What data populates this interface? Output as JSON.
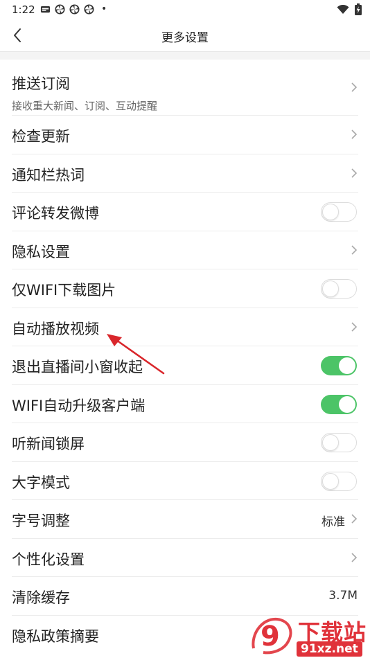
{
  "status_bar": {
    "time": "1:22",
    "dot": "•",
    "icons": [
      "app-notification-icon",
      "pinwheel-icon",
      "pinwheel-icon",
      "pinwheel-icon",
      "wifi-icon",
      "battery-charging-icon"
    ]
  },
  "header": {
    "title": "更多设置",
    "back_icon": "back-chevron-icon"
  },
  "settings": [
    {
      "label": "推送订阅",
      "subtitle": "接收重大新闻、订阅、互动提醒",
      "control": "chevron"
    },
    {
      "label": "检查更新",
      "control": "chevron"
    },
    {
      "label": "通知栏热词",
      "control": "chevron"
    },
    {
      "label": "评论转发微博",
      "control": "toggle",
      "on": false
    },
    {
      "label": "隐私设置",
      "control": "chevron"
    },
    {
      "label": "仅WIFI下载图片",
      "control": "toggle",
      "on": false
    },
    {
      "label": "自动播放视频",
      "control": "chevron"
    },
    {
      "label": "退出直播间小窗收起",
      "control": "toggle",
      "on": true
    },
    {
      "label": "WIFI自动升级客户端",
      "control": "toggle",
      "on": true
    },
    {
      "label": "听新闻锁屏",
      "control": "toggle",
      "on": false
    },
    {
      "label": "大字模式",
      "control": "toggle",
      "on": false
    },
    {
      "label": "字号调整",
      "value": "标准",
      "control": "chevron"
    },
    {
      "label": "个性化设置",
      "control": "chevron"
    },
    {
      "label": "清除缓存",
      "value": "3.7M",
      "control": "none"
    },
    {
      "label": "隐私政策摘要",
      "control": "none"
    }
  ],
  "colors": {
    "toggle_on": "#4cc467",
    "annotation_arrow": "#d9262b",
    "watermark": "#e0323a"
  },
  "watermark": {
    "brand": "下载站",
    "domain": "91xz.net",
    "logo_text": "9"
  }
}
